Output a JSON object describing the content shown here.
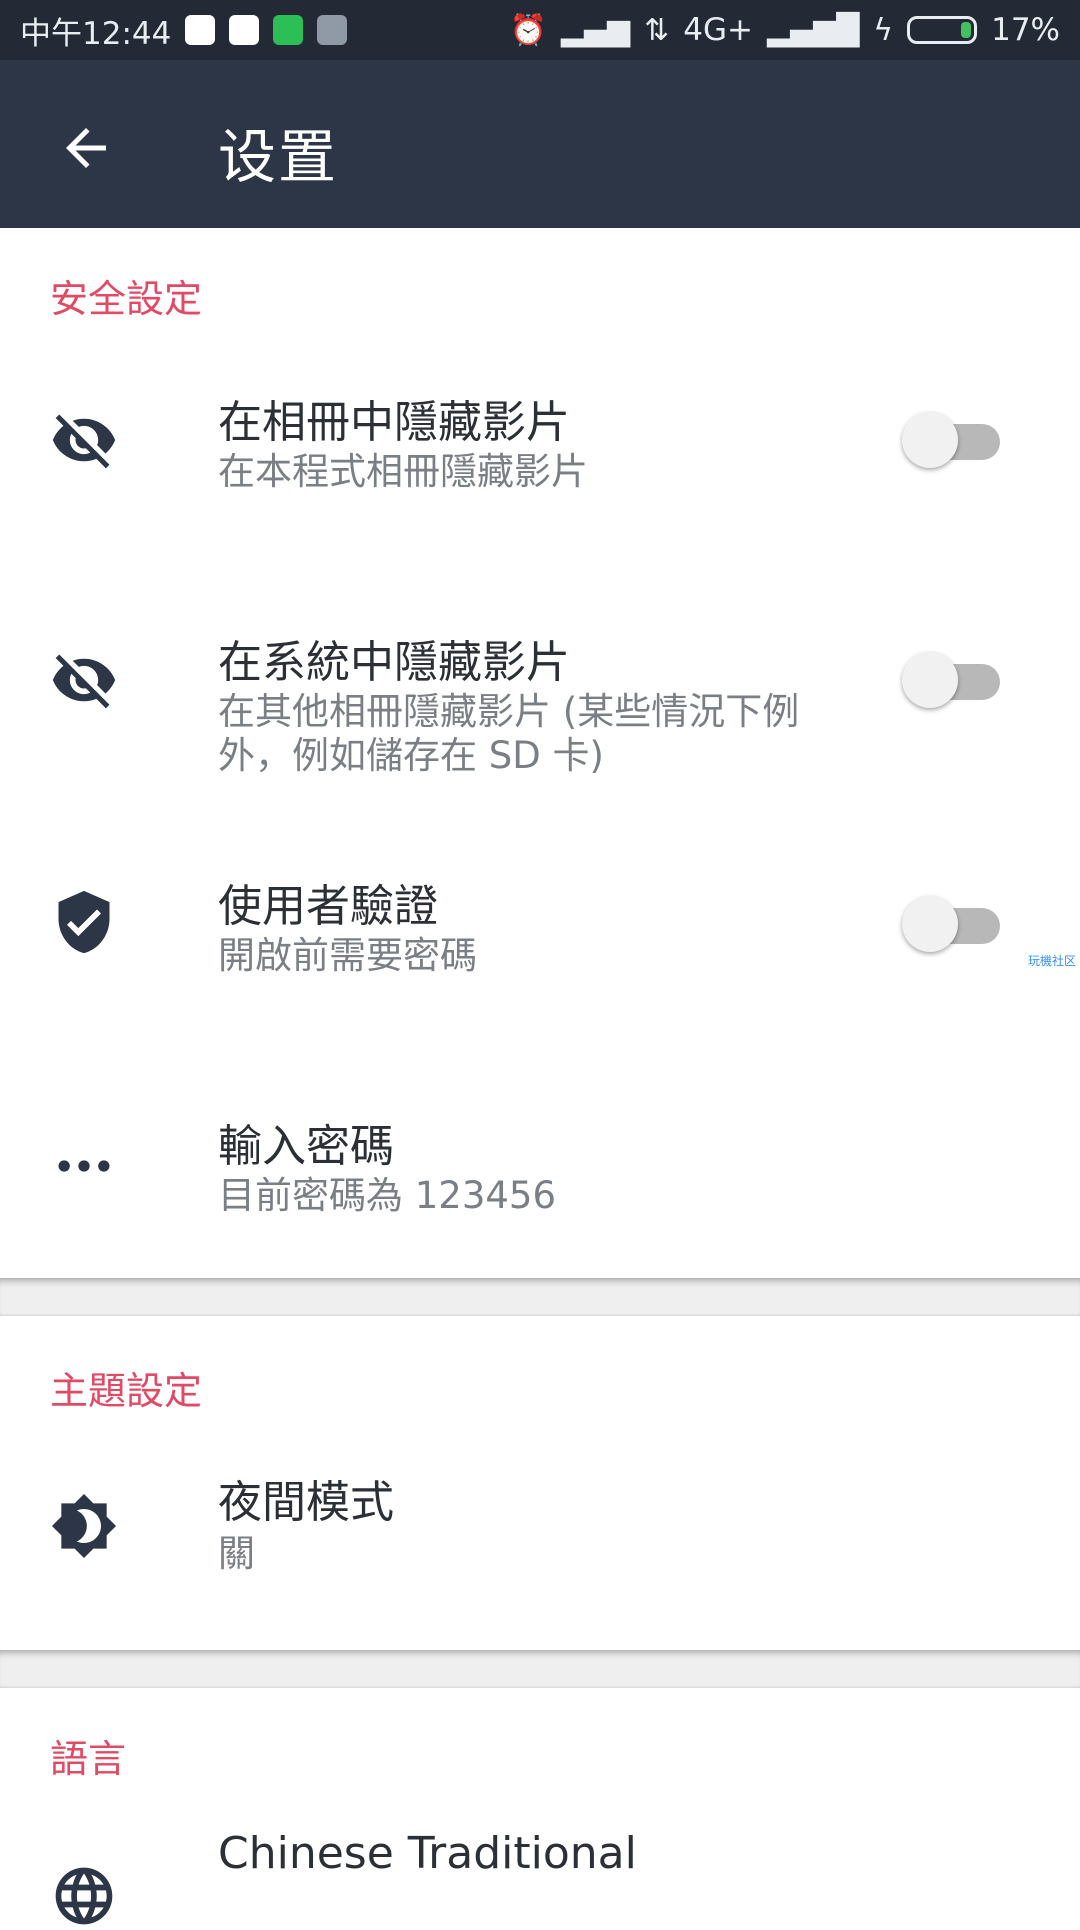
{
  "status_bar": {
    "time": "中午12:44",
    "network": "4G+",
    "battery": "17%",
    "battery_level": 0.17
  },
  "appbar": {
    "back_icon": "arrow-back-icon",
    "title": "设置"
  },
  "security": {
    "header": "安全設定",
    "items": [
      {
        "icon": "eye-off-icon",
        "title": "在相冊中隱藏影片",
        "subtitle": "在本程式相冊隱藏影片",
        "toggle_on": false
      },
      {
        "icon": "eye-off-icon",
        "title": "在系統中隱藏影片",
        "subtitle": "在其他相冊隱藏影片 (某些情況下例外，例如儲存在 SD 卡)",
        "toggle_on": false
      },
      {
        "icon": "shield-check-icon",
        "title": "使用者驗證",
        "subtitle": "開啟前需要密碼",
        "toggle_on": false
      },
      {
        "icon": "dots-icon",
        "title": "輸入密碼",
        "subtitle": "目前密碼為 123456"
      }
    ]
  },
  "theme": {
    "header": "主題設定",
    "items": [
      {
        "icon": "brightness-icon",
        "title": "夜間模式",
        "subtitle": "關"
      }
    ]
  },
  "language": {
    "header": "語言",
    "items": [
      {
        "icon": "globe-icon",
        "title": "Chinese Traditional"
      }
    ]
  },
  "watermark": "玩機社区",
  "colors": {
    "accent": "#e14a64",
    "appbar": "#2c3646",
    "statusbar": "#232a35"
  }
}
